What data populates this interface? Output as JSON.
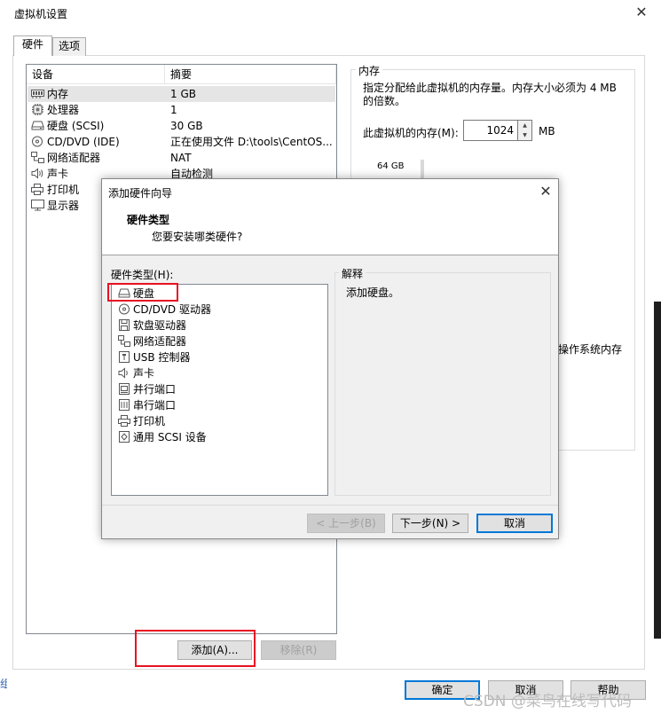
{
  "outer": {
    "title": "虚拟机设置",
    "tabs": [
      {
        "label": "硬件"
      },
      {
        "label": "选项"
      }
    ],
    "device_list": {
      "headers": {
        "device": "设备",
        "summary": "摘要"
      },
      "rows": [
        {
          "name": "内存",
          "summary": "1 GB",
          "icon": "memory-icon"
        },
        {
          "name": "处理器",
          "summary": "1",
          "icon": "processor-icon"
        },
        {
          "name": "硬盘 (SCSI)",
          "summary": "30 GB",
          "icon": "hard-disk-icon"
        },
        {
          "name": "CD/DVD (IDE)",
          "summary": "正在使用文件 D:\\tools\\CentOS...",
          "icon": "cd-dvd-icon"
        },
        {
          "name": "网络适配器",
          "summary": "NAT",
          "icon": "network-adapter-icon"
        },
        {
          "name": "声卡",
          "summary": "自动检测",
          "icon": "sound-card-icon"
        },
        {
          "name": "打印机",
          "summary": "",
          "icon": "printer-icon"
        },
        {
          "name": "显示器",
          "summary": "",
          "icon": "display-icon"
        }
      ]
    },
    "buttons": {
      "add": "添加(A)...",
      "remove": "移除(R)",
      "ok": "确定",
      "cancel": "取消",
      "help": "帮助"
    },
    "memory": {
      "legend": "内存",
      "description": "指定分配给此虚拟机的内存量。内存大小必须为 4 MB 的倍数。",
      "label": "此虚拟机的内存(M):",
      "value": "1024",
      "unit": "MB",
      "slider_top_mark": "64 GB",
      "os_memory_text": "操作系统内存"
    },
    "watermark": "CSDN @菜鸟在线写代码",
    "cut_left_text": "组"
  },
  "wizard": {
    "title": "添加硬件向导",
    "heading": "硬件类型",
    "subheading": "您要安装哪类硬件?",
    "list_label": "硬件类型(H):",
    "items": [
      {
        "name": "硬盘",
        "icon": "hard-disk-icon"
      },
      {
        "name": "CD/DVD 驱动器",
        "icon": "cd-dvd-drive-icon"
      },
      {
        "name": "软盘驱动器",
        "icon": "floppy-drive-icon"
      },
      {
        "name": "网络适配器",
        "icon": "network-adapter-icon"
      },
      {
        "name": "USB 控制器",
        "icon": "usb-controller-icon"
      },
      {
        "name": "声卡",
        "icon": "sound-card-icon"
      },
      {
        "name": "并行端口",
        "icon": "parallel-port-icon"
      },
      {
        "name": "串行端口",
        "icon": "serial-port-icon"
      },
      {
        "name": "打印机",
        "icon": "printer-icon"
      },
      {
        "name": "通用 SCSI 设备",
        "icon": "generic-scsi-icon"
      }
    ],
    "explain_legend": "解释",
    "explain_text": "添加硬盘。",
    "buttons": {
      "back": "< 上一步(B)",
      "next": "下一步(N) >",
      "cancel": "取消"
    }
  },
  "colors": {
    "highlight_red": "#e81123",
    "default_button_border": "#0078d7",
    "dialog_bg": "#f0f0f0"
  }
}
